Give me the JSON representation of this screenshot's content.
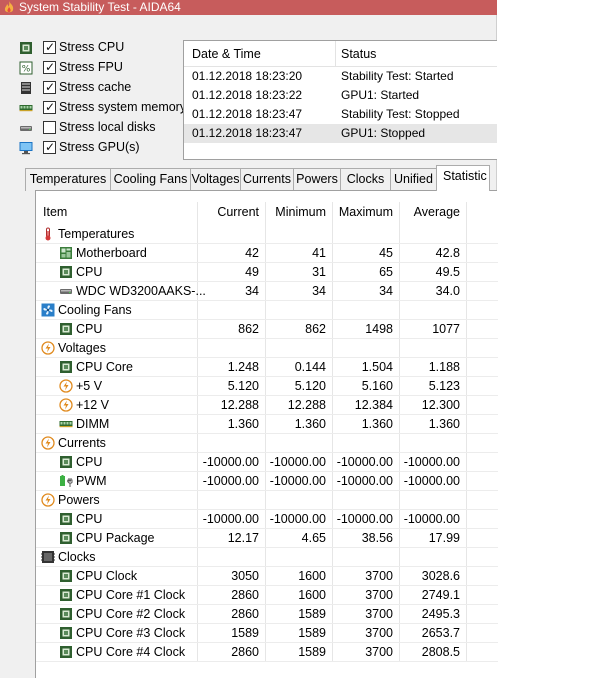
{
  "window": {
    "title": "System Stability Test - AIDA64"
  },
  "stress_options": [
    {
      "label": "Stress CPU",
      "checked": true,
      "icon": "cpu-chip-icon"
    },
    {
      "label": "Stress FPU",
      "checked": true,
      "icon": "fpu-percent-icon"
    },
    {
      "label": "Stress cache",
      "checked": true,
      "icon": "cache-icon"
    },
    {
      "label": "Stress system memory",
      "checked": true,
      "icon": "memory-module-icon"
    },
    {
      "label": "Stress local disks",
      "checked": false,
      "icon": "disk-drive-icon"
    },
    {
      "label": "Stress GPU(s)",
      "checked": true,
      "icon": "gpu-monitor-icon"
    }
  ],
  "log": {
    "headers": {
      "date": "Date & Time",
      "status": "Status"
    },
    "rows": [
      {
        "date": "01.12.2018 18:23:20",
        "status": "Stability Test: Started"
      },
      {
        "date": "01.12.2018 18:23:22",
        "status": "GPU1: Started"
      },
      {
        "date": "01.12.2018 18:23:47",
        "status": "Stability Test: Stopped"
      },
      {
        "date": "01.12.2018 18:23:47",
        "status": "GPU1: Stopped"
      }
    ]
  },
  "tabs": [
    "Temperatures",
    "Cooling Fans",
    "Voltages",
    "Currents",
    "Powers",
    "Clocks",
    "Unified",
    "Statistic"
  ],
  "active_tab": "Statistic",
  "stats": {
    "headers": {
      "item": "Item",
      "current": "Current",
      "minimum": "Minimum",
      "maximum": "Maximum",
      "average": "Average"
    },
    "rows": [
      {
        "type": "group",
        "label": "Temperatures",
        "icon": "thermometer-icon"
      },
      {
        "type": "item",
        "label": "Motherboard",
        "icon": "motherboard-icon",
        "cur": "42",
        "min": "41",
        "max": "45",
        "avg": "42.8"
      },
      {
        "type": "item",
        "label": "CPU",
        "icon": "cpu-chip-icon",
        "cur": "49",
        "min": "31",
        "max": "65",
        "avg": "49.5"
      },
      {
        "type": "item",
        "label": "WDC WD3200AAKS-...",
        "icon": "disk-drive-icon",
        "cur": "34",
        "min": "34",
        "max": "34",
        "avg": "34.0"
      },
      {
        "type": "group",
        "label": "Cooling Fans",
        "icon": "fan-icon"
      },
      {
        "type": "item",
        "label": "CPU",
        "icon": "cpu-chip-icon",
        "cur": "862",
        "min": "862",
        "max": "1498",
        "avg": "1077"
      },
      {
        "type": "group",
        "label": "Voltages",
        "icon": "voltage-icon"
      },
      {
        "type": "item",
        "label": "CPU Core",
        "icon": "cpu-chip-icon",
        "cur": "1.248",
        "min": "0.144",
        "max": "1.504",
        "avg": "1.188"
      },
      {
        "type": "item",
        "label": "+5 V",
        "icon": "voltage-icon",
        "cur": "5.120",
        "min": "5.120",
        "max": "5.160",
        "avg": "5.123"
      },
      {
        "type": "item",
        "label": "+12 V",
        "icon": "voltage-icon",
        "cur": "12.288",
        "min": "12.288",
        "max": "12.384",
        "avg": "12.300"
      },
      {
        "type": "item",
        "label": "DIMM",
        "icon": "memory-module-icon",
        "cur": "1.360",
        "min": "1.360",
        "max": "1.360",
        "avg": "1.360"
      },
      {
        "type": "group",
        "label": "Currents",
        "icon": "voltage-icon"
      },
      {
        "type": "item",
        "label": "CPU",
        "icon": "cpu-chip-icon",
        "cur": "-10000.00",
        "min": "-10000.00",
        "max": "-10000.00",
        "avg": "-10000.00"
      },
      {
        "type": "item",
        "label": "PWM",
        "icon": "battery-plug-icon",
        "cur": "-10000.00",
        "min": "-10000.00",
        "max": "-10000.00",
        "avg": "-10000.00"
      },
      {
        "type": "group",
        "label": "Powers",
        "icon": "voltage-icon"
      },
      {
        "type": "item",
        "label": "CPU",
        "icon": "cpu-chip-icon",
        "cur": "-10000.00",
        "min": "-10000.00",
        "max": "-10000.00",
        "avg": "-10000.00"
      },
      {
        "type": "item",
        "label": "CPU Package",
        "icon": "cpu-chip-icon",
        "cur": "12.17",
        "min": "4.65",
        "max": "38.56",
        "avg": "17.99"
      },
      {
        "type": "group",
        "label": "Clocks",
        "icon": "clock-chip-icon"
      },
      {
        "type": "item",
        "label": "CPU Clock",
        "icon": "cpu-chip-icon",
        "cur": "3050",
        "min": "1600",
        "max": "3700",
        "avg": "3028.6"
      },
      {
        "type": "item",
        "label": "CPU Core #1 Clock",
        "icon": "cpu-chip-icon",
        "cur": "2860",
        "min": "1600",
        "max": "3700",
        "avg": "2749.1"
      },
      {
        "type": "item",
        "label": "CPU Core #2 Clock",
        "icon": "cpu-chip-icon",
        "cur": "2860",
        "min": "1589",
        "max": "3700",
        "avg": "2495.3"
      },
      {
        "type": "item",
        "label": "CPU Core #3 Clock",
        "icon": "cpu-chip-icon",
        "cur": "1589",
        "min": "1589",
        "max": "3700",
        "avg": "2653.7"
      },
      {
        "type": "item",
        "label": "CPU Core #4 Clock",
        "icon": "cpu-chip-icon",
        "cur": "2860",
        "min": "1589",
        "max": "3700",
        "avg": "2808.5"
      }
    ]
  }
}
